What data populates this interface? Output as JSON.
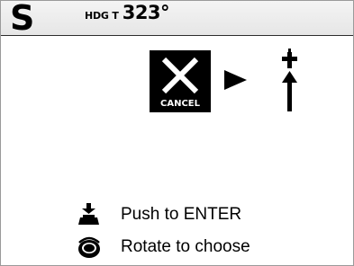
{
  "header": {
    "mode_letter": "S",
    "hdg_label": "HDG T",
    "hdg_value": "323°"
  },
  "main": {
    "cancel_label": "CANCEL",
    "instructions": [
      {
        "icon": "push-enter-icon",
        "text": "Push to ENTER"
      },
      {
        "icon": "rotate-knob-icon",
        "text": "Rotate to choose"
      }
    ]
  }
}
